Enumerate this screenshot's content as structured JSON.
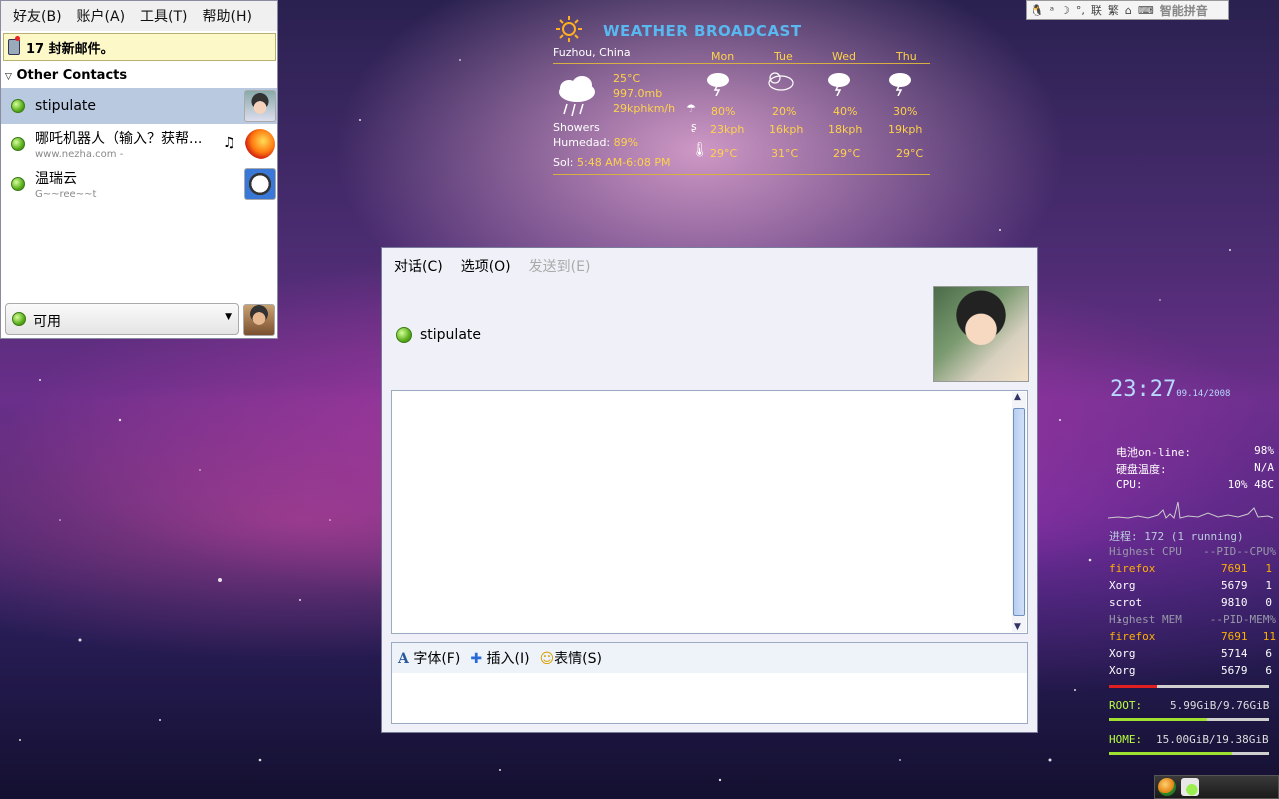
{
  "im": {
    "menu": [
      "好友(B)",
      "账户(A)",
      "工具(T)",
      "帮助(H)"
    ],
    "mail_notice": "17 封新邮件。",
    "group": "Other Contacts",
    "contacts": [
      {
        "name": "stipulate",
        "sub": ""
      },
      {
        "name": "哪吒机器人（输入？获帮...",
        "sub": "www.nezha.com -"
      },
      {
        "name": "温瑞云",
        "sub": "G~~ree~~t"
      }
    ],
    "status": "可用"
  },
  "weather": {
    "title": "WEATHER BROADCAST",
    "location": "Fuzhou, China",
    "current": {
      "temp": "25°C",
      "pressure": "997.0mb",
      "wind": "29kphkm/h",
      "condition": "Showers",
      "humidity_label": "Humedad:",
      "humidity": "89%",
      "sun_label": "Sol:",
      "sun": "5:48 AM-6:08 PM"
    },
    "forecast": [
      {
        "day": "Mon",
        "precip": "80%",
        "wind": "23kph",
        "temp": "29°C"
      },
      {
        "day": "Tue",
        "precip": "20%",
        "wind": "16kph",
        "temp": "31°C"
      },
      {
        "day": "Wed",
        "precip": "40%",
        "wind": "18kph",
        "temp": "29°C"
      },
      {
        "day": "Thu",
        "precip": "30%",
        "wind": "19kph",
        "temp": "29°C"
      }
    ],
    "colors": {
      "text": "#ffd24a",
      "title": "#58b8f0"
    }
  },
  "chat": {
    "menu": [
      "对话(C)",
      "选项(O)",
      "发送到(E)"
    ],
    "buddy": "stipulate",
    "tools": [
      "字体(F)",
      "插入(I)",
      "表情(S)"
    ]
  },
  "clock": {
    "time": "23:27",
    "date": "09.14/2008"
  },
  "sysmon": {
    "battery_label": "电池on-line:",
    "battery": "98%",
    "disk_temp_label": "硬盘温度:",
    "disk_temp": "N/A",
    "cpu_label": "CPU:",
    "cpu": "10% 48C",
    "proc_label": "进程:",
    "proc": "172  (1 running)",
    "cpu_header": "Highest CPU",
    "cpu_cols": "--PID--CPU%",
    "cpu_top": [
      {
        "name": "firefox",
        "pid": "7691",
        "val": "1"
      },
      {
        "name": "Xorg",
        "pid": "5679",
        "val": "1"
      },
      {
        "name": "scrot",
        "pid": "9810",
        "val": "0"
      }
    ],
    "mem_header": "Highest MEM",
    "mem_cols": "--PID-MEM%",
    "mem_top": [
      {
        "name": "firefox",
        "pid": "7691",
        "val": "11"
      },
      {
        "name": "Xorg",
        "pid": "5714",
        "val": "6"
      },
      {
        "name": "Xorg",
        "pid": "5679",
        "val": "6"
      }
    ],
    "mem_fill": 0.3,
    "root_label": "ROOT:",
    "root": "5.99GiB/9.76GiB",
    "root_fill": 0.61,
    "home_label": "HOME:",
    "home": "15.00GiB/19.38GiB",
    "home_fill": 0.77
  },
  "ime": {
    "label": "智能拼音",
    "keys": [
      "联",
      "繁",
      "⌂"
    ]
  }
}
